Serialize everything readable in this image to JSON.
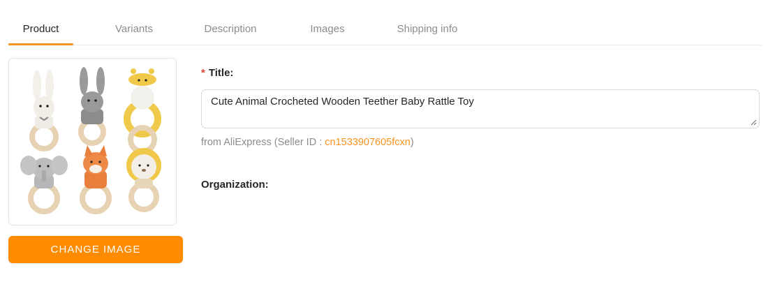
{
  "tabs": [
    {
      "label": "Product",
      "active": true
    },
    {
      "label": "Variants",
      "active": false
    },
    {
      "label": "Description",
      "active": false
    },
    {
      "label": "Images",
      "active": false
    },
    {
      "label": "Shipping info",
      "active": false
    }
  ],
  "product": {
    "change_image_label": "CHANGE IMAGE",
    "title_label": "Title",
    "title_colon": ":",
    "title_required_mark": "*",
    "title_value": "Cute Animal Crocheted Wooden Teether Baby Rattle Toy",
    "source_prefix": "from AliExpress (Seller ID : ",
    "seller_id": "cn1533907605fcxn",
    "source_suffix": ")",
    "organization_label": "Organization",
    "organization_colon": ":"
  },
  "colors": {
    "accent": "#ff8c00",
    "tab_underline": "#f7931e",
    "link": "#f7931e",
    "required": "#e0463a"
  }
}
